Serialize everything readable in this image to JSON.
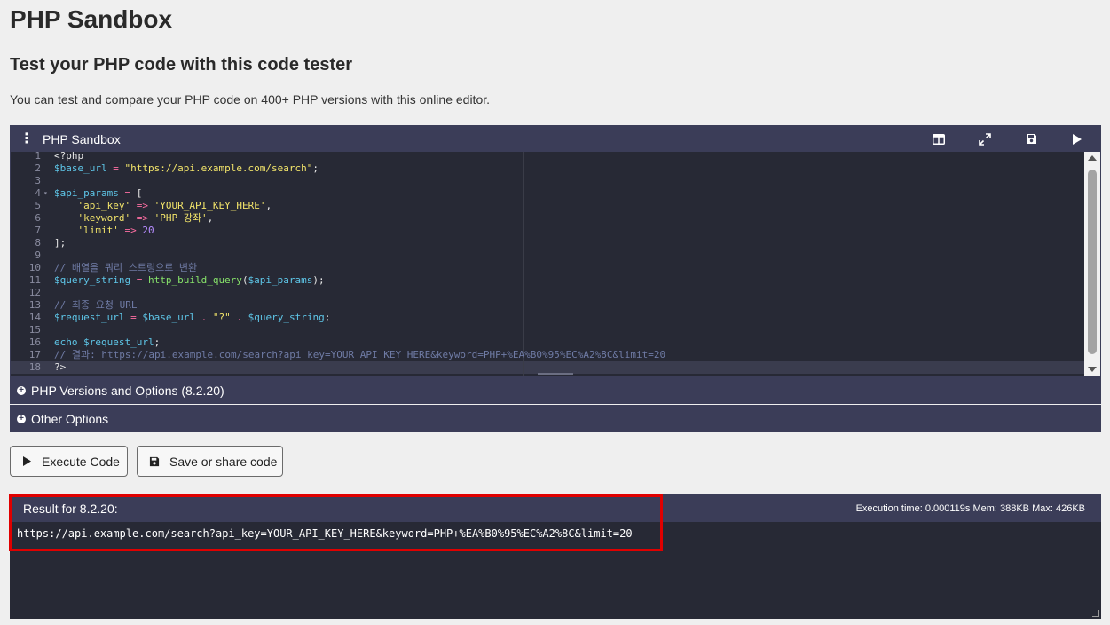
{
  "page": {
    "title": "PHP Sandbox",
    "subtitle": "Test your PHP code with this code tester",
    "intro": "You can test and compare your PHP code on 400+ PHP versions with this online editor."
  },
  "editor": {
    "title": "PHP Sandbox",
    "menu_icon": "kebab-menu-icon",
    "tools": [
      "split-view-icon",
      "fullscreen-icon",
      "save-icon",
      "run-icon"
    ],
    "line_numbers": [
      "1",
      "2",
      "3",
      "4",
      "5",
      "6",
      "7",
      "8",
      "9",
      "10",
      "11",
      "12",
      "13",
      "14",
      "15",
      "16",
      "17",
      "18"
    ],
    "active_line": 18,
    "lines": [
      [
        {
          "t": "<?php",
          "c": ""
        }
      ],
      [
        {
          "t": "$base_url",
          "c": "var"
        },
        {
          "t": " = ",
          "c": "op"
        },
        {
          "t": "\"https://api.example.com/search\"",
          "c": "str"
        },
        {
          "t": ";",
          "c": ""
        }
      ],
      [],
      [
        {
          "t": "$api_params",
          "c": "var"
        },
        {
          "t": " = ",
          "c": "op"
        },
        {
          "t": "[",
          "c": ""
        }
      ],
      [
        {
          "t": "    ",
          "c": ""
        },
        {
          "t": "'api_key'",
          "c": "str"
        },
        {
          "t": " => ",
          "c": "op"
        },
        {
          "t": "'YOUR_API_KEY_HERE'",
          "c": "str"
        },
        {
          "t": ",",
          "c": ""
        }
      ],
      [
        {
          "t": "    ",
          "c": ""
        },
        {
          "t": "'keyword'",
          "c": "str"
        },
        {
          "t": " => ",
          "c": "op"
        },
        {
          "t": "'PHP 강좌'",
          "c": "str"
        },
        {
          "t": ",",
          "c": ""
        }
      ],
      [
        {
          "t": "    ",
          "c": ""
        },
        {
          "t": "'limit'",
          "c": "str"
        },
        {
          "t": " => ",
          "c": "op"
        },
        {
          "t": "20",
          "c": "num"
        }
      ],
      [
        {
          "t": "];",
          "c": ""
        }
      ],
      [],
      [
        {
          "t": "// 배열을 쿼리 스트링으로 변환",
          "c": "cm"
        }
      ],
      [
        {
          "t": "$query_string",
          "c": "var"
        },
        {
          "t": " = ",
          "c": "op"
        },
        {
          "t": "http_build_query",
          "c": "fn"
        },
        {
          "t": "(",
          "c": ""
        },
        {
          "t": "$api_params",
          "c": "var"
        },
        {
          "t": ");",
          "c": ""
        }
      ],
      [],
      [
        {
          "t": "// 최종 요청 URL",
          "c": "cm"
        }
      ],
      [
        {
          "t": "$request_url",
          "c": "var"
        },
        {
          "t": " = ",
          "c": "op"
        },
        {
          "t": "$base_url",
          "c": "var"
        },
        {
          "t": " . ",
          "c": "op"
        },
        {
          "t": "\"?\"",
          "c": "str"
        },
        {
          "t": " . ",
          "c": "op"
        },
        {
          "t": "$query_string",
          "c": "var"
        },
        {
          "t": ";",
          "c": ""
        }
      ],
      [],
      [
        {
          "t": "echo",
          "c": "kw"
        },
        {
          "t": " ",
          "c": ""
        },
        {
          "t": "$request_url",
          "c": "var"
        },
        {
          "t": ";",
          "c": ""
        }
      ],
      [
        {
          "t": "// 결과: https://api.example.com/search?api_key=YOUR_API_KEY_HERE&keyword=PHP+%EA%B0%95%EC%A2%8C&limit=20",
          "c": "cm"
        }
      ],
      [
        {
          "t": "?>",
          "c": ""
        }
      ]
    ]
  },
  "options": {
    "versions_label": "PHP Versions and Options (8.2.20)",
    "other_label": "Other Options",
    "expand_icon": "plus-circle-icon"
  },
  "buttons": {
    "execute_label": "Execute Code",
    "save_label": "Save or share code"
  },
  "result": {
    "title": "Result for 8.2.20:",
    "exec_info": "Execution time: 0.000119s Mem: 388KB Max: 426KB",
    "output": "https://api.example.com/search?api_key=YOUR_API_KEY_HERE&keyword=PHP+%EA%B0%95%EC%A2%8C&limit=20"
  },
  "colors": {
    "panel_header": "#3b3d58",
    "editor_bg": "#272935",
    "highlight": "#e00000"
  }
}
